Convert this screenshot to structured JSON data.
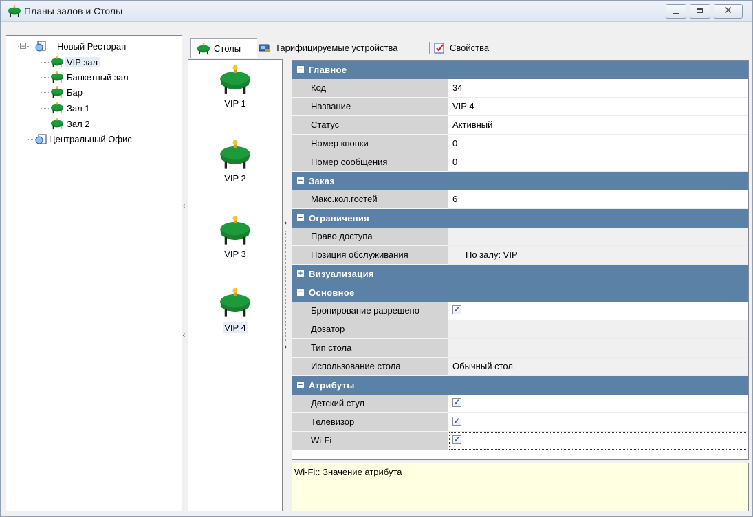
{
  "window": {
    "title": "Планы залов и Столы"
  },
  "tree": {
    "root": {
      "label": "Новый Ресторан"
    },
    "halls": [
      {
        "label": "VIP зал"
      },
      {
        "label": "Банкетный зал"
      },
      {
        "label": "Бар"
      },
      {
        "label": "Зал 1"
      },
      {
        "label": "Зал 2"
      }
    ],
    "office": {
      "label": "Центральный Офис"
    }
  },
  "tabs": [
    {
      "label": "Столы"
    },
    {
      "label": "Тарифицируемые устройства"
    },
    {
      "label": "Свойства"
    }
  ],
  "tables": [
    {
      "label": "VIP 1"
    },
    {
      "label": "VIP 2"
    },
    {
      "label": "VIP 3"
    },
    {
      "label": "VIP 4"
    }
  ],
  "properties": {
    "main": {
      "title": "Главное",
      "rows": [
        {
          "name": "Код",
          "value": "34"
        },
        {
          "name": "Название",
          "value": "VIP 4"
        },
        {
          "name": "Статус",
          "value": "Активный"
        },
        {
          "name": "Номер кнопки",
          "value": "0"
        },
        {
          "name": "Номер сообщения",
          "value": "0"
        }
      ]
    },
    "order": {
      "title": "Заказ",
      "rows": [
        {
          "name": "Макс.кол.гостей",
          "value": "6"
        }
      ]
    },
    "limits": {
      "title": "Ограничения",
      "rows": [
        {
          "name": "Право доступа",
          "value": ""
        },
        {
          "name": "Позиция обслуживания",
          "value": "По залу: VIP"
        }
      ]
    },
    "visual": {
      "title": "Визуализация"
    },
    "basic": {
      "title": "Основное",
      "rows": [
        {
          "name": "Бронирование разрешено",
          "checked": true
        },
        {
          "name": "Дозатор",
          "value": ""
        },
        {
          "name": "Тип стола",
          "value": ""
        },
        {
          "name": "Использование стола",
          "value": "Обычный стол"
        }
      ]
    },
    "attrs": {
      "title": "Атрибуты",
      "rows": [
        {
          "name": "Детский стул",
          "checked": true
        },
        {
          "name": "Телевизор",
          "checked": true
        },
        {
          "name": "Wi-Fi",
          "checked": true
        }
      ]
    }
  },
  "description": {
    "text": "Wi-Fi:: Значение атрибута"
  },
  "colors": {
    "category_bar": "#5b81a6",
    "description_bg": "#ffffe1",
    "table_cloth": "#1c9a3c"
  }
}
